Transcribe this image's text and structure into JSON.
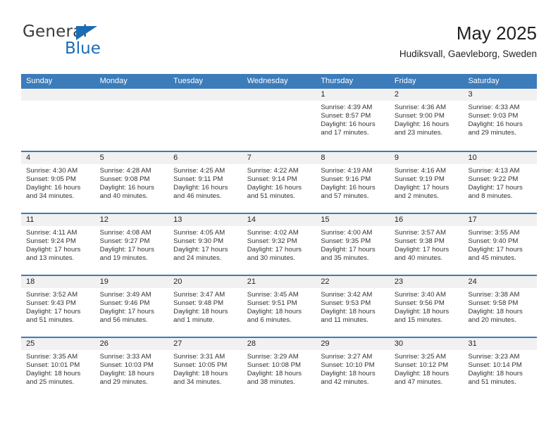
{
  "brand": {
    "name_top": "General",
    "name_bottom": "Blue",
    "triangle_color": "#1b6cb5",
    "text_color": "#3b3b3b"
  },
  "header": {
    "title": "May 2025",
    "subtitle": "Hudiksvall, Gaevleborg, Sweden"
  },
  "theme": {
    "header_blue": "#3c7cba",
    "day_band_gray": "#f1f1f1",
    "text": "#231f20"
  },
  "calendar": {
    "weekdays": [
      "Sunday",
      "Monday",
      "Tuesday",
      "Wednesday",
      "Thursday",
      "Friday",
      "Saturday"
    ],
    "weeks": [
      [
        {
          "day": "",
          "sunrise": "",
          "sunset": "",
          "daylight_1": "",
          "daylight_2": ""
        },
        {
          "day": "",
          "sunrise": "",
          "sunset": "",
          "daylight_1": "",
          "daylight_2": ""
        },
        {
          "day": "",
          "sunrise": "",
          "sunset": "",
          "daylight_1": "",
          "daylight_2": ""
        },
        {
          "day": "",
          "sunrise": "",
          "sunset": "",
          "daylight_1": "",
          "daylight_2": ""
        },
        {
          "day": "1",
          "sunrise": "Sunrise: 4:39 AM",
          "sunset": "Sunset: 8:57 PM",
          "daylight_1": "Daylight: 16 hours",
          "daylight_2": "and 17 minutes."
        },
        {
          "day": "2",
          "sunrise": "Sunrise: 4:36 AM",
          "sunset": "Sunset: 9:00 PM",
          "daylight_1": "Daylight: 16 hours",
          "daylight_2": "and 23 minutes."
        },
        {
          "day": "3",
          "sunrise": "Sunrise: 4:33 AM",
          "sunset": "Sunset: 9:03 PM",
          "daylight_1": "Daylight: 16 hours",
          "daylight_2": "and 29 minutes."
        }
      ],
      [
        {
          "day": "4",
          "sunrise": "Sunrise: 4:30 AM",
          "sunset": "Sunset: 9:05 PM",
          "daylight_1": "Daylight: 16 hours",
          "daylight_2": "and 34 minutes."
        },
        {
          "day": "5",
          "sunrise": "Sunrise: 4:28 AM",
          "sunset": "Sunset: 9:08 PM",
          "daylight_1": "Daylight: 16 hours",
          "daylight_2": "and 40 minutes."
        },
        {
          "day": "6",
          "sunrise": "Sunrise: 4:25 AM",
          "sunset": "Sunset: 9:11 PM",
          "daylight_1": "Daylight: 16 hours",
          "daylight_2": "and 46 minutes."
        },
        {
          "day": "7",
          "sunrise": "Sunrise: 4:22 AM",
          "sunset": "Sunset: 9:14 PM",
          "daylight_1": "Daylight: 16 hours",
          "daylight_2": "and 51 minutes."
        },
        {
          "day": "8",
          "sunrise": "Sunrise: 4:19 AM",
          "sunset": "Sunset: 9:16 PM",
          "daylight_1": "Daylight: 16 hours",
          "daylight_2": "and 57 minutes."
        },
        {
          "day": "9",
          "sunrise": "Sunrise: 4:16 AM",
          "sunset": "Sunset: 9:19 PM",
          "daylight_1": "Daylight: 17 hours",
          "daylight_2": "and 2 minutes."
        },
        {
          "day": "10",
          "sunrise": "Sunrise: 4:13 AM",
          "sunset": "Sunset: 9:22 PM",
          "daylight_1": "Daylight: 17 hours",
          "daylight_2": "and 8 minutes."
        }
      ],
      [
        {
          "day": "11",
          "sunrise": "Sunrise: 4:11 AM",
          "sunset": "Sunset: 9:24 PM",
          "daylight_1": "Daylight: 17 hours",
          "daylight_2": "and 13 minutes."
        },
        {
          "day": "12",
          "sunrise": "Sunrise: 4:08 AM",
          "sunset": "Sunset: 9:27 PM",
          "daylight_1": "Daylight: 17 hours",
          "daylight_2": "and 19 minutes."
        },
        {
          "day": "13",
          "sunrise": "Sunrise: 4:05 AM",
          "sunset": "Sunset: 9:30 PM",
          "daylight_1": "Daylight: 17 hours",
          "daylight_2": "and 24 minutes."
        },
        {
          "day": "14",
          "sunrise": "Sunrise: 4:02 AM",
          "sunset": "Sunset: 9:32 PM",
          "daylight_1": "Daylight: 17 hours",
          "daylight_2": "and 30 minutes."
        },
        {
          "day": "15",
          "sunrise": "Sunrise: 4:00 AM",
          "sunset": "Sunset: 9:35 PM",
          "daylight_1": "Daylight: 17 hours",
          "daylight_2": "and 35 minutes."
        },
        {
          "day": "16",
          "sunrise": "Sunrise: 3:57 AM",
          "sunset": "Sunset: 9:38 PM",
          "daylight_1": "Daylight: 17 hours",
          "daylight_2": "and 40 minutes."
        },
        {
          "day": "17",
          "sunrise": "Sunrise: 3:55 AM",
          "sunset": "Sunset: 9:40 PM",
          "daylight_1": "Daylight: 17 hours",
          "daylight_2": "and 45 minutes."
        }
      ],
      [
        {
          "day": "18",
          "sunrise": "Sunrise: 3:52 AM",
          "sunset": "Sunset: 9:43 PM",
          "daylight_1": "Daylight: 17 hours",
          "daylight_2": "and 51 minutes."
        },
        {
          "day": "19",
          "sunrise": "Sunrise: 3:49 AM",
          "sunset": "Sunset: 9:46 PM",
          "daylight_1": "Daylight: 17 hours",
          "daylight_2": "and 56 minutes."
        },
        {
          "day": "20",
          "sunrise": "Sunrise: 3:47 AM",
          "sunset": "Sunset: 9:48 PM",
          "daylight_1": "Daylight: 18 hours",
          "daylight_2": "and 1 minute."
        },
        {
          "day": "21",
          "sunrise": "Sunrise: 3:45 AM",
          "sunset": "Sunset: 9:51 PM",
          "daylight_1": "Daylight: 18 hours",
          "daylight_2": "and 6 minutes."
        },
        {
          "day": "22",
          "sunrise": "Sunrise: 3:42 AM",
          "sunset": "Sunset: 9:53 PM",
          "daylight_1": "Daylight: 18 hours",
          "daylight_2": "and 11 minutes."
        },
        {
          "day": "23",
          "sunrise": "Sunrise: 3:40 AM",
          "sunset": "Sunset: 9:56 PM",
          "daylight_1": "Daylight: 18 hours",
          "daylight_2": "and 15 minutes."
        },
        {
          "day": "24",
          "sunrise": "Sunrise: 3:38 AM",
          "sunset": "Sunset: 9:58 PM",
          "daylight_1": "Daylight: 18 hours",
          "daylight_2": "and 20 minutes."
        }
      ],
      [
        {
          "day": "25",
          "sunrise": "Sunrise: 3:35 AM",
          "sunset": "Sunset: 10:01 PM",
          "daylight_1": "Daylight: 18 hours",
          "daylight_2": "and 25 minutes."
        },
        {
          "day": "26",
          "sunrise": "Sunrise: 3:33 AM",
          "sunset": "Sunset: 10:03 PM",
          "daylight_1": "Daylight: 18 hours",
          "daylight_2": "and 29 minutes."
        },
        {
          "day": "27",
          "sunrise": "Sunrise: 3:31 AM",
          "sunset": "Sunset: 10:05 PM",
          "daylight_1": "Daylight: 18 hours",
          "daylight_2": "and 34 minutes."
        },
        {
          "day": "28",
          "sunrise": "Sunrise: 3:29 AM",
          "sunset": "Sunset: 10:08 PM",
          "daylight_1": "Daylight: 18 hours",
          "daylight_2": "and 38 minutes."
        },
        {
          "day": "29",
          "sunrise": "Sunrise: 3:27 AM",
          "sunset": "Sunset: 10:10 PM",
          "daylight_1": "Daylight: 18 hours",
          "daylight_2": "and 42 minutes."
        },
        {
          "day": "30",
          "sunrise": "Sunrise: 3:25 AM",
          "sunset": "Sunset: 10:12 PM",
          "daylight_1": "Daylight: 18 hours",
          "daylight_2": "and 47 minutes."
        },
        {
          "day": "31",
          "sunrise": "Sunrise: 3:23 AM",
          "sunset": "Sunset: 10:14 PM",
          "daylight_1": "Daylight: 18 hours",
          "daylight_2": "and 51 minutes."
        }
      ]
    ]
  }
}
